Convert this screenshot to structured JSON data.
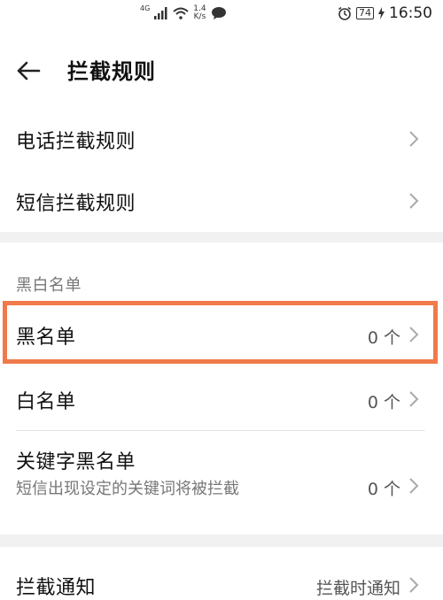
{
  "status_bar": {
    "network": "4G",
    "speed_value": "1.4",
    "speed_unit": "K/s",
    "battery": "74",
    "time": "16:50"
  },
  "header": {
    "title": "拦截规则"
  },
  "rules": {
    "phone": "电话拦截规则",
    "sms": "短信拦截规则"
  },
  "lists": {
    "section_title": "黑白名单",
    "blacklist": {
      "label": "黑名单",
      "value": "0 个"
    },
    "whitelist": {
      "label": "白名单",
      "value": "0 个"
    },
    "keyword_blacklist": {
      "label": "关键字黑名单",
      "description": "短信出现设定的关键词将被拦截",
      "value": "0 个"
    }
  },
  "notify": {
    "label": "拦截通知",
    "value": "拦截时通知"
  },
  "colors": {
    "highlight": "#f07a4a",
    "gap": "#f1f1f1"
  }
}
